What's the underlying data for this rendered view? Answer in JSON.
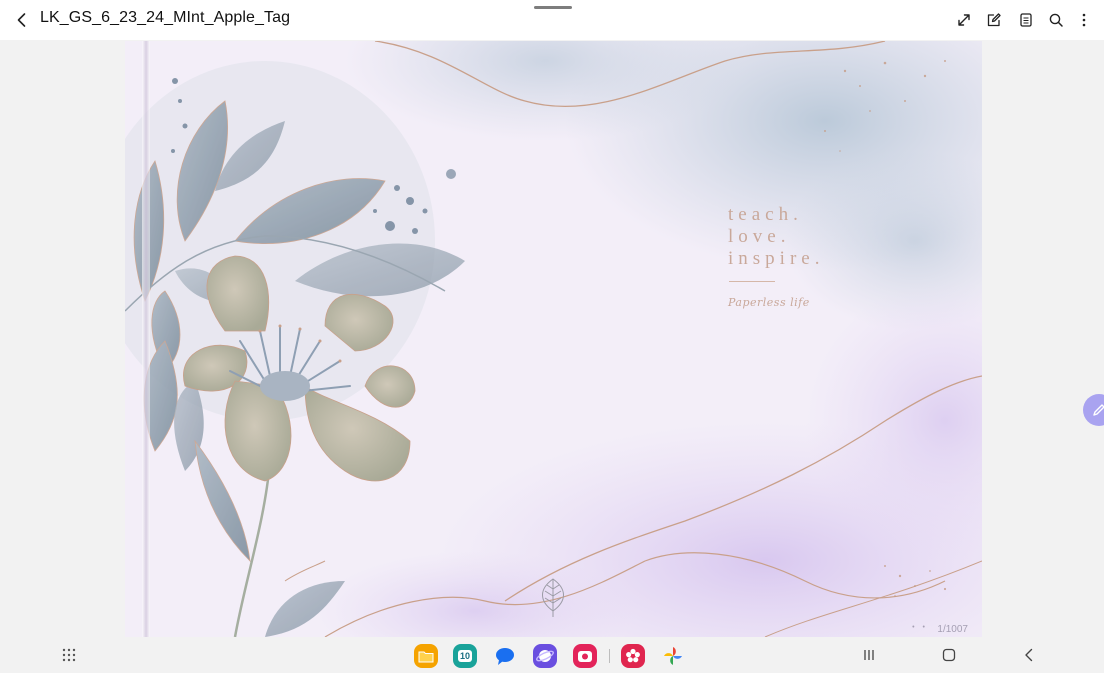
{
  "document": {
    "title": "LK_GS_6_23_24_MInt_Apple_Tag"
  },
  "toolbar": {
    "icons": [
      "back-icon",
      "expand-icon",
      "edit-icon",
      "page-view-icon",
      "search-icon",
      "more-icon"
    ]
  },
  "page": {
    "tagline": [
      "teach.",
      "love.",
      "inspire."
    ],
    "script": "Paperless life",
    "counter": "1/1007",
    "dots": "• •"
  },
  "dock": {
    "calendar_day": "10",
    "apps": [
      "my-files",
      "calendar",
      "messages",
      "internet",
      "screen-recorder",
      "gallery",
      "photos"
    ]
  },
  "colors": {
    "accent_fab": "#a9a3f0",
    "tagline": "#c9a89a",
    "page_bg": "#f3eef8"
  }
}
